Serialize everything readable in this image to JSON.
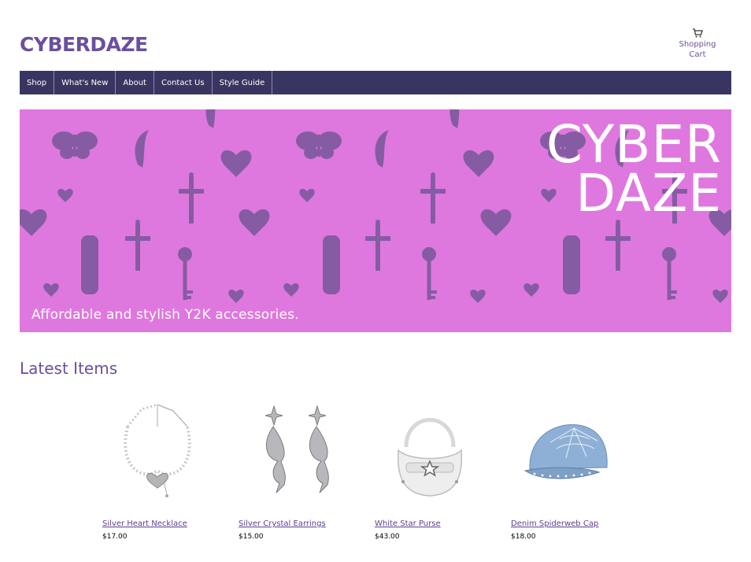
{
  "header": {
    "logo": "CYBERDAZE",
    "cart_line1": "Shopping",
    "cart_line2": "Cart",
    "cart_icon": "shopping-cart-icon"
  },
  "nav": {
    "items": [
      {
        "label": "Shop"
      },
      {
        "label": "What's New"
      },
      {
        "label": "About"
      },
      {
        "label": "Contact Us"
      },
      {
        "label": "Style Guide"
      }
    ]
  },
  "hero": {
    "title_line1": "CYBER",
    "title_line2": "DAZE",
    "tagline": "Affordable and stylish Y2K accessories.",
    "background_color": "#df78de",
    "pattern_color": "#7b5a9c"
  },
  "latest": {
    "title": "Latest Items",
    "products": [
      {
        "name": "Silver Heart Necklace",
        "price": "$17.00"
      },
      {
        "name": "Silver Crystal Earrings",
        "price": "$15.00"
      },
      {
        "name": "White Star Purse",
        "price": "$43.00"
      },
      {
        "name": "Denim Spiderweb Cap",
        "price": "$18.00"
      }
    ]
  },
  "colors": {
    "brand": "#6b4f9e",
    "nav_bg": "#383660"
  }
}
